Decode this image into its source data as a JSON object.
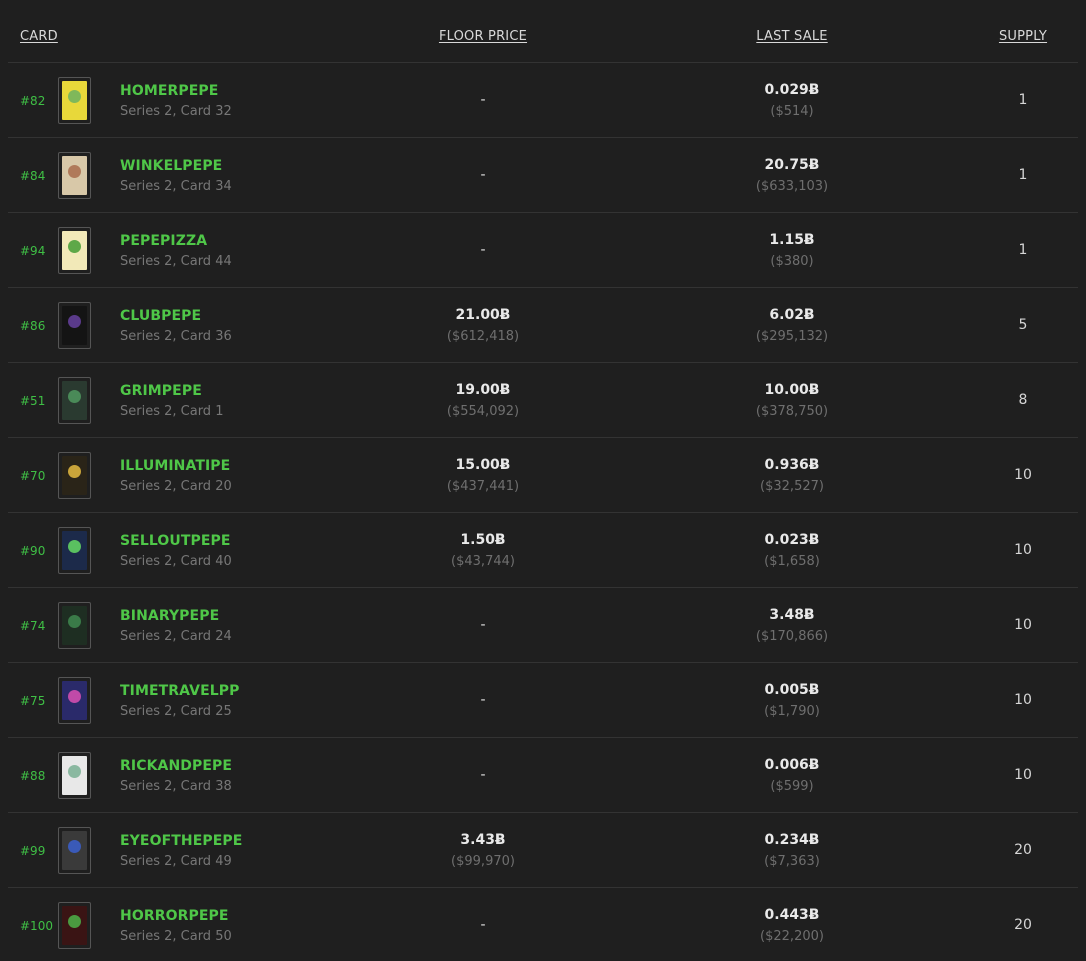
{
  "headers": {
    "card": "CARD",
    "floor_price": "FLOOR PRICE",
    "last_sale": "LAST SALE",
    "supply": "SUPPLY"
  },
  "rows": [
    {
      "id": "#82",
      "name": "HOMERPEPE",
      "series": "Series 2, Card 32",
      "floor": "-",
      "floor_usd": "",
      "last": "0.029Ƀ",
      "last_usd": "($514)",
      "supply": "1",
      "thumb_bg": "#e8d83a",
      "thumb_face": "#7fb85a"
    },
    {
      "id": "#84",
      "name": "WINKELPEPE",
      "series": "Series 2, Card 34",
      "floor": "-",
      "floor_usd": "",
      "last": "20.75Ƀ",
      "last_usd": "($633,103)",
      "supply": "1",
      "thumb_bg": "#d8c8a8",
      "thumb_face": "#b07a5a"
    },
    {
      "id": "#94",
      "name": "PEPEPIZZA",
      "series": "Series 2, Card 44",
      "floor": "-",
      "floor_usd": "",
      "last": "1.15Ƀ",
      "last_usd": "($380)",
      "supply": "1",
      "thumb_bg": "#f2e9b8",
      "thumb_face": "#5ea848"
    },
    {
      "id": "#86",
      "name": "CLUBPEPE",
      "series": "Series 2, Card 36",
      "floor": "21.00Ƀ",
      "floor_usd": "($612,418)",
      "last": "6.02Ƀ",
      "last_usd": "($295,132)",
      "supply": "5",
      "thumb_bg": "#141414",
      "thumb_face": "#5a3a8a"
    },
    {
      "id": "#51",
      "name": "GRIMPEPE",
      "series": "Series 2, Card 1",
      "floor": "19.00Ƀ",
      "floor_usd": "($554,092)",
      "last": "10.00Ƀ",
      "last_usd": "($378,750)",
      "supply": "8",
      "thumb_bg": "#2a3a30",
      "thumb_face": "#4a8a58"
    },
    {
      "id": "#70",
      "name": "ILLUMINATIPE",
      "series": "Series 2, Card 20",
      "floor": "15.00Ƀ",
      "floor_usd": "($437,441)",
      "last": "0.936Ƀ",
      "last_usd": "($32,527)",
      "supply": "10",
      "thumb_bg": "#2a2418",
      "thumb_face": "#c9a43a"
    },
    {
      "id": "#90",
      "name": "SELLOUTPEPE",
      "series": "Series 2, Card 40",
      "floor": "1.50Ƀ",
      "floor_usd": "($43,744)",
      "last": "0.023Ƀ",
      "last_usd": "($1,658)",
      "supply": "10",
      "thumb_bg": "#1c2a4a",
      "thumb_face": "#5ac060"
    },
    {
      "id": "#74",
      "name": "BINARYPEPE",
      "series": "Series 2, Card 24",
      "floor": "-",
      "floor_usd": "",
      "last": "3.48Ƀ",
      "last_usd": "($170,866)",
      "supply": "10",
      "thumb_bg": "#1e2e22",
      "thumb_face": "#3a7a48"
    },
    {
      "id": "#75",
      "name": "TIMETRAVELPP",
      "series": "Series 2, Card 25",
      "floor": "-",
      "floor_usd": "",
      "last": "0.005Ƀ",
      "last_usd": "($1,790)",
      "supply": "10",
      "thumb_bg": "#2a2a6a",
      "thumb_face": "#c04aa8"
    },
    {
      "id": "#88",
      "name": "RICKANDPEPE",
      "series": "Series 2, Card 38",
      "floor": "-",
      "floor_usd": "",
      "last": "0.006Ƀ",
      "last_usd": "($599)",
      "supply": "10",
      "thumb_bg": "#e8e8e8",
      "thumb_face": "#8ab8a0"
    },
    {
      "id": "#99",
      "name": "EYEOFTHEPEPE",
      "series": "Series 2, Card 49",
      "floor": "3.43Ƀ",
      "floor_usd": "($99,970)",
      "last": "0.234Ƀ",
      "last_usd": "($7,363)",
      "supply": "20",
      "thumb_bg": "#3a3a3a",
      "thumb_face": "#3a5ab8"
    },
    {
      "id": "#100",
      "name": "HORRORPEPE",
      "series": "Series 2, Card 50",
      "floor": "-",
      "floor_usd": "",
      "last": "0.443Ƀ",
      "last_usd": "($22,200)",
      "supply": "20",
      "thumb_bg": "#3a1414",
      "thumb_face": "#4a9a40"
    }
  ]
}
